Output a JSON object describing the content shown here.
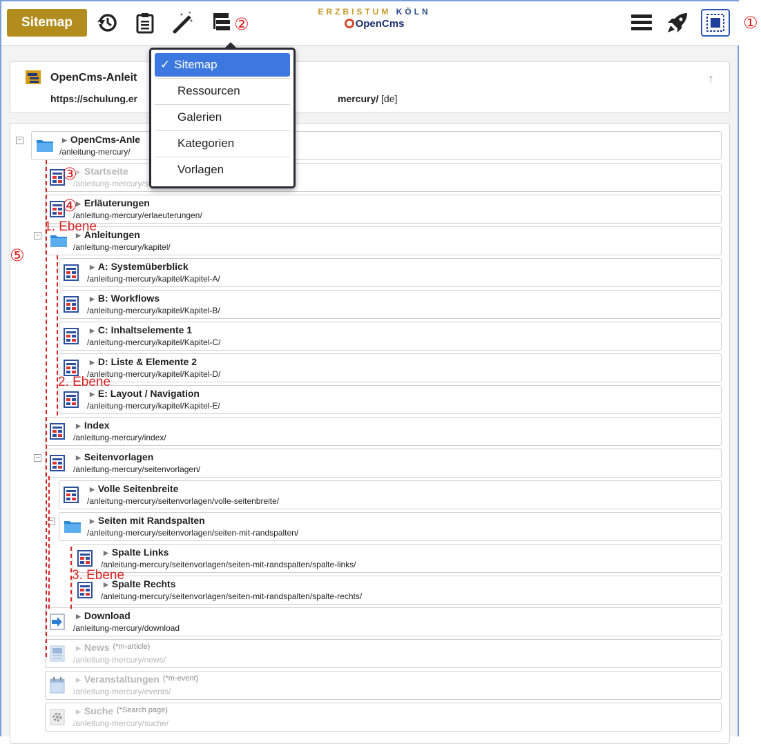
{
  "toolbar": {
    "sitemap_button": "Sitemap",
    "logo_top_left": "ERZBISTUM ",
    "logo_top_right": "KÖLN",
    "logo_bottom": "OpenCms",
    "icons": [
      "history-icon",
      "clipboard-icon",
      "magic-wand-icon",
      "sitemap-tree-icon",
      "menu-icon",
      "rocket-icon",
      "publish-icon"
    ]
  },
  "markers": {
    "m1": "①",
    "m2": "②",
    "m3": "③",
    "m4": "④",
    "m5": "⑤",
    "level1": "1. Ebene",
    "level2": "2. Ebene",
    "level3": "3. Ebene"
  },
  "header": {
    "title": "OpenCms-Anleit",
    "url_left": "https://schulung.er",
    "url_right": "mercury/",
    "lang": "[de]",
    "up_icon": "↑"
  },
  "dropdown": {
    "items": [
      {
        "label": "Sitemap",
        "selected": true,
        "check": "✓"
      },
      {
        "label": "Ressourcen"
      },
      {
        "label": "Galerien"
      },
      {
        "label": "Kategorien"
      },
      {
        "label": "Vorlagen"
      }
    ]
  },
  "tree": {
    "nodes": [
      {
        "title": "OpenCms-Anle",
        "path": "/anleitung-mercury/",
        "icon": "folder"
      },
      {
        "title": "Startseite",
        "path": "/anleitung-mercury/start/",
        "icon": "page",
        "faded": true
      },
      {
        "title": "Erläuterungen",
        "path": "/anleitung-mercury/erlaeuterungen/",
        "icon": "page"
      },
      {
        "title": "Anleitungen",
        "path": "/anleitung-mercury/kapitel/",
        "icon": "folder"
      },
      {
        "title": "A: Systemüberblick",
        "path": "/anleitung-mercury/kapitel/Kapitel-A/",
        "icon": "page"
      },
      {
        "title": "B: Workflows",
        "path": "/anleitung-mercury/kapitel/Kapitel-B/",
        "icon": "page"
      },
      {
        "title": "C: Inhaltselemente 1",
        "path": "/anleitung-mercury/kapitel/Kapitel-C/",
        "icon": "page"
      },
      {
        "title": "D: Liste & Elemente 2",
        "path": "/anleitung-mercury/kapitel/Kapitel-D/",
        "icon": "page"
      },
      {
        "title": "E: Layout / Navigation",
        "path": "/anleitung-mercury/kapitel/Kapitel-E/",
        "icon": "page"
      },
      {
        "title": "Index",
        "path": "/anleitung-mercury/index/",
        "icon": "page"
      },
      {
        "title": "Seitenvorlagen",
        "path": "/anleitung-mercury/seitenvorlagen/",
        "icon": "page"
      },
      {
        "title": "Volle Seitenbreite",
        "path": "/anleitung-mercury/seitenvorlagen/volle-seitenbreite/",
        "icon": "page"
      },
      {
        "title": "Seiten mit Randspalten",
        "path": "/anleitung-mercury/seitenvorlagen/seiten-mit-randspalten/",
        "icon": "folder"
      },
      {
        "title": "Spalte Links",
        "path": "/anleitung-mercury/seitenvorlagen/seiten-mit-randspalten/spalte-links/",
        "icon": "page"
      },
      {
        "title": "Spalte Rechts",
        "path": "/anleitung-mercury/seitenvorlagen/seiten-mit-randspalten/spalte-rechts/",
        "icon": "page"
      },
      {
        "title": "Download",
        "path": "/anleitung-mercury/download",
        "icon": "link"
      },
      {
        "title": "News",
        "meta": "(*m-article)",
        "path": "/anleitung-mercury/news/",
        "icon": "news",
        "faded": true
      },
      {
        "title": "Veranstaltungen",
        "meta": "(*m-event)",
        "path": "/anleitung-mercury/events/",
        "icon": "calendar",
        "faded": true
      },
      {
        "title": "Suche",
        "meta": "(*Search page)",
        "path": "/anleitung-mercury/suche/",
        "icon": "gear",
        "faded": true
      }
    ]
  },
  "colors": {
    "accent_gold": "#b38c1e",
    "annotation_red": "#d92323",
    "selection_blue": "#3d78e0"
  }
}
